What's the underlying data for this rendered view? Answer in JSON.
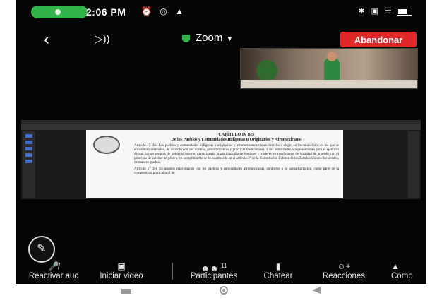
{
  "status_bar": {
    "time": "2:06 PM",
    "left_icons": "⏰ ◎ ▲",
    "right_icons": "✱ ▣ ☰"
  },
  "meeting_bar": {
    "back_icon": "chevron-left-icon",
    "speaker_icon": "speaker-icon",
    "title": "Zoom",
    "leave_label": "Abandonar",
    "accent": "#e02828",
    "secure_color": "#2fb54a"
  },
  "shared_document": {
    "heading_1": "CAPÍTULO IV BIS",
    "heading_2": "De los Pueblos y Comunidades Indígenas u Originarios y Afromexicanos",
    "para_1": "Artículo 17 Bis. Los pueblos y comunidades indígenas u originarios y afromexicanos tienen derecho a elegir, en los municipios en los que se encuentran asentados, de acuerdo con sus normas, procedimientos y prácticas tradicionales, a sus autoridades o representantes para el ejercicio de sus formas propias de gobierno interno, garantizando la participación de hombres y mujeres en condiciones de igualdad de acuerdo con el principio de paridad de género, en cumplimiento de lo establecido en el artículo 2° de la Constitución Política de los Estados Unidos Mexicanos, de manera gradual.",
    "para_2": "Artículo 17 Ter. En asuntos relacionados con los pueblos y comunidades afromexicanas, conforme a su autoadscripción, como parte de la composición pluricultural de"
  },
  "toolbar": {
    "items": [
      {
        "icon": "mic-off-icon",
        "label": "Reactivar auc"
      },
      {
        "icon": "video-off-icon",
        "label": "Iniciar video"
      },
      {
        "icon": "participants-icon",
        "label": "Participantes",
        "badge": "11"
      },
      {
        "icon": "chat-icon",
        "label": "Chatear"
      },
      {
        "icon": "reactions-icon",
        "label": "Reacciones"
      },
      {
        "icon": "share-icon",
        "label": "Comp"
      }
    ]
  }
}
